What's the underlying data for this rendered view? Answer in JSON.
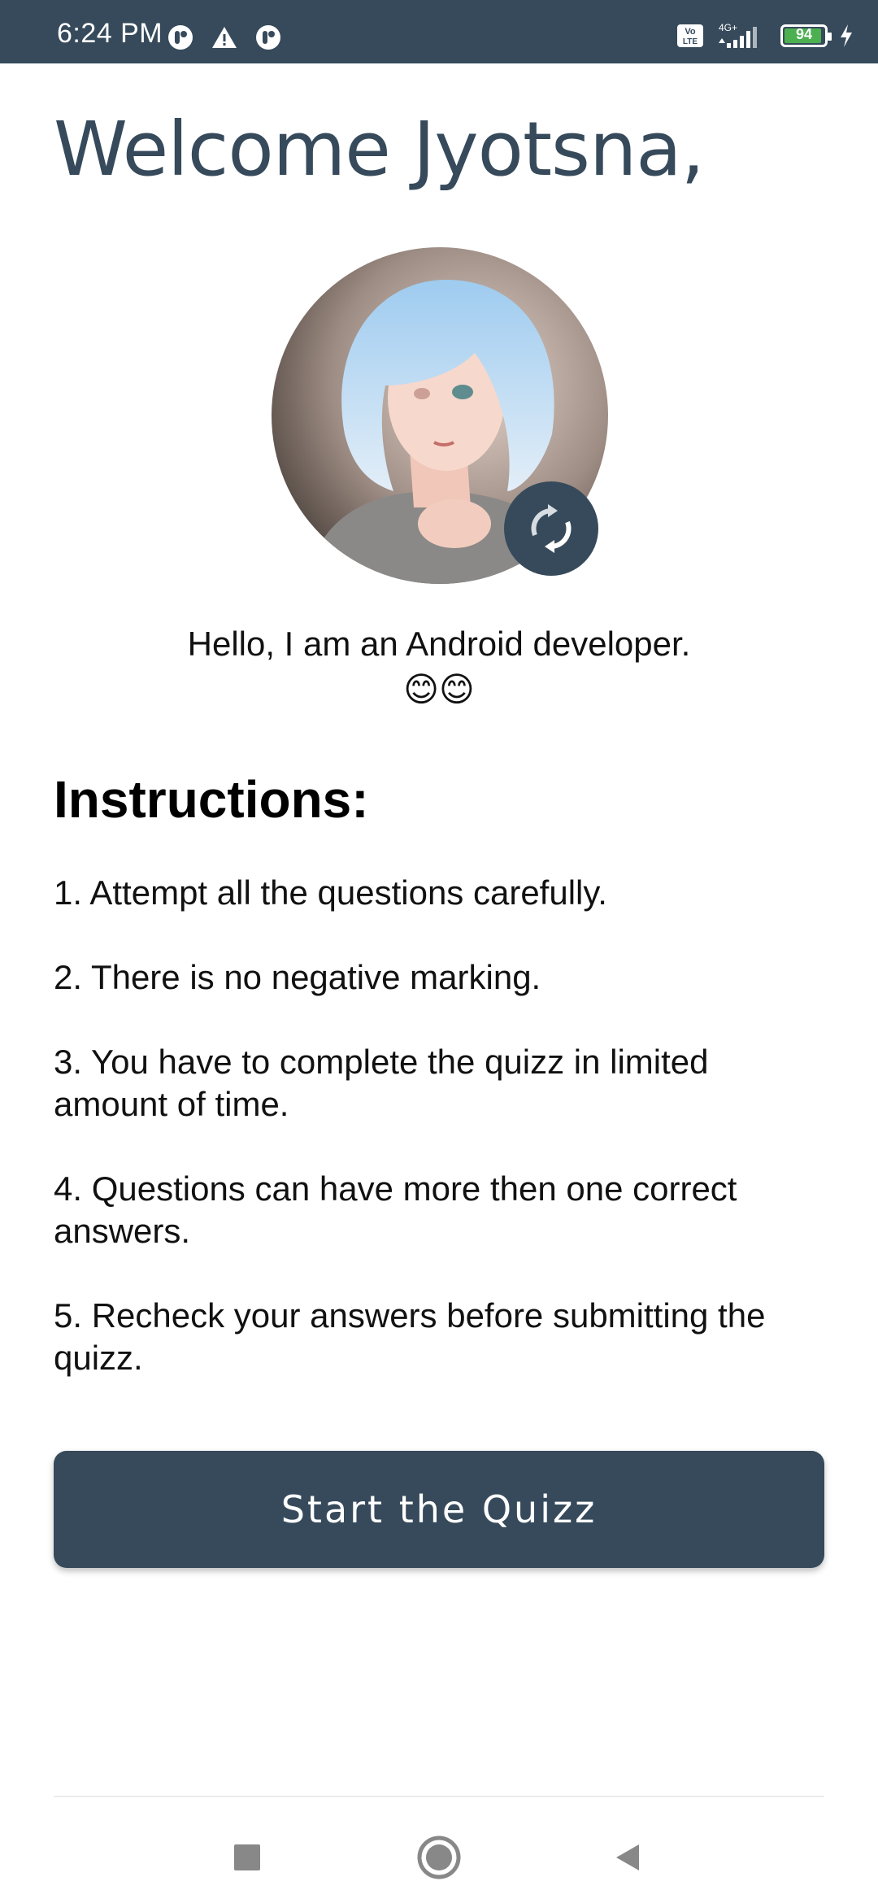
{
  "status_bar": {
    "time": "6:24 PM",
    "icons": [
      "notification-icon",
      "warning-icon",
      "notification-icon",
      "volte-icon",
      "signal-icon"
    ],
    "network": "4G+",
    "volte": "Vo LTE",
    "battery_level": 94,
    "battery_text": "94",
    "charging": true
  },
  "header": {
    "welcome": "Welcome Jyotsna,"
  },
  "profile": {
    "bio": "Hello, I am an Android developer.",
    "emoji": "😊😊"
  },
  "instructions": {
    "title": "Instructions:",
    "items": [
      "1. Attempt all the questions carefully.",
      "2. There is no negative marking.",
      "3. You have to complete the quizz in limited amount of time.",
      "4. Questions can have more then one correct answers.",
      "5. Recheck your answers before submitting the quizz."
    ]
  },
  "start_button": {
    "label": "Start the Quizz"
  },
  "colors": {
    "primary": "#364a5b",
    "battery": "#4caf50"
  },
  "nav": {
    "icons": [
      "recents-square-icon",
      "home-circle-icon",
      "back-triangle-icon"
    ]
  }
}
